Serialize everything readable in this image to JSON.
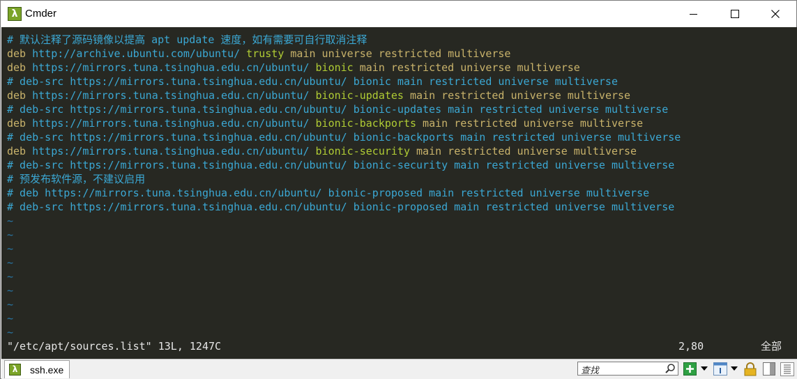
{
  "window": {
    "title": "Cmder",
    "app_icon": "lambda-icon",
    "controls": [
      "minimize-icon",
      "maximize-icon",
      "close-icon"
    ]
  },
  "terminal": {
    "colors": {
      "background": "#272822",
      "comment": "#3ba8d4",
      "keyword": "#c9b36b",
      "suite": "#b0cc34",
      "tilde": "#2978a8",
      "status": "#e6e6e6"
    },
    "lines": [
      {
        "comment": "# 默认注释了源码镜像以提高 apt update 速度，如有需要可自行取消注释"
      },
      {
        "deb": "deb",
        "url": " http://archive.ubuntu.com/ubuntu/",
        "suite": " trusty",
        "rest": " main universe restricted multiverse"
      },
      {
        "deb": "deb",
        "url": " https://mirrors.tuna.tsinghua.edu.cn/ubuntu/",
        "suite": " bionic",
        "rest": " main restricted universe multiverse"
      },
      {
        "comment": "# deb-src https://mirrors.tuna.tsinghua.edu.cn/ubuntu/ bionic main restricted universe multiverse"
      },
      {
        "deb": "deb",
        "url": " https://mirrors.tuna.tsinghua.edu.cn/ubuntu/",
        "suite": " bionic-updates",
        "rest": " main restricted universe multiverse"
      },
      {
        "comment": "# deb-src https://mirrors.tuna.tsinghua.edu.cn/ubuntu/ bionic-updates main restricted universe multiverse"
      },
      {
        "deb": "deb",
        "url": " https://mirrors.tuna.tsinghua.edu.cn/ubuntu/",
        "suite": " bionic-backports",
        "rest": " main restricted universe multiverse"
      },
      {
        "comment": "# deb-src https://mirrors.tuna.tsinghua.edu.cn/ubuntu/ bionic-backports main restricted universe multiverse"
      },
      {
        "deb": "deb",
        "url": " https://mirrors.tuna.tsinghua.edu.cn/ubuntu/",
        "suite": " bionic-security",
        "rest": " main restricted universe multiverse"
      },
      {
        "comment": "# deb-src https://mirrors.tuna.tsinghua.edu.cn/ubuntu/ bionic-security main restricted universe multiverse"
      },
      {
        "comment": "# 预发布软件源，不建议启用"
      },
      {
        "comment": "# deb https://mirrors.tuna.tsinghua.edu.cn/ubuntu/ bionic-proposed main restricted universe multiverse"
      },
      {
        "comment": "# deb-src https://mirrors.tuna.tsinghua.edu.cn/ubuntu/ bionic-proposed main restricted universe multiverse"
      },
      {
        "tilde": "~"
      },
      {
        "tilde": "~"
      },
      {
        "tilde": "~"
      },
      {
        "tilde": "~"
      },
      {
        "tilde": "~"
      },
      {
        "tilde": "~"
      },
      {
        "tilde": "~"
      },
      {
        "tilde": "~"
      },
      {
        "tilde": "~"
      }
    ],
    "status": {
      "file": "\"/etc/apt/sources.list\" 13L, 1247C",
      "position": "2,80",
      "scroll": "全部"
    }
  },
  "bottombar": {
    "tab_label": "ssh.exe",
    "tab_icon": "lambda-icon",
    "search_placeholder": "查找",
    "tools": [
      "search-icon",
      "new-console-icon",
      "dropdown-icon",
      "pane-icon",
      "dropdown-icon",
      "lock-icon",
      "split-icon",
      "resize-grip-icon"
    ]
  }
}
